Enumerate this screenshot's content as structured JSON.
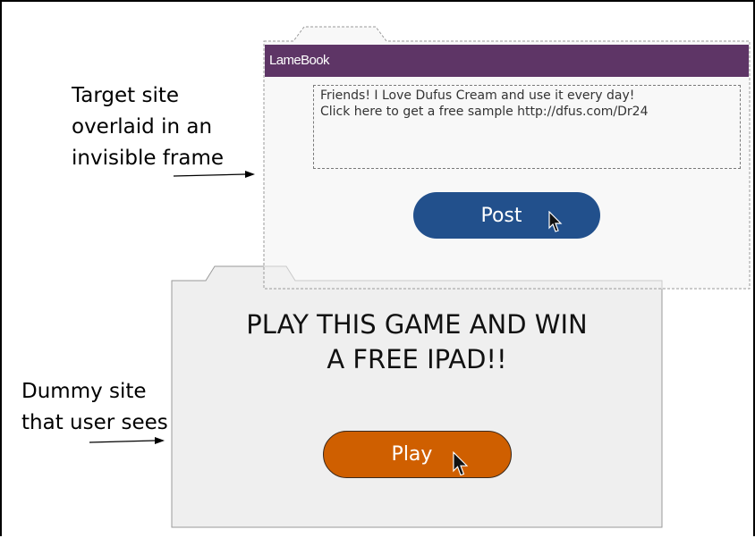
{
  "labels": {
    "target": "Target site\noverlaid in an\ninvisible frame",
    "dummy": "Dummy site\nthat user sees"
  },
  "target_site": {
    "brand": "LameBook",
    "post_text": "Friends! I Love Dufus Cream and use it every day!\nClick here to get a free sample http://dfus.com/Dr24",
    "post_button": "Post"
  },
  "dummy_site": {
    "headline": "PLAY THIS GAME AND WIN\nA FREE IPAD!!",
    "play_button": "Play"
  },
  "colors": {
    "brand_bar": "#5e3566",
    "post_button": "#22508c",
    "play_button": "#cf5f00",
    "panel": "#efefef"
  },
  "icons": [
    "mouse-pointer-icon",
    "arrow-icon"
  ]
}
